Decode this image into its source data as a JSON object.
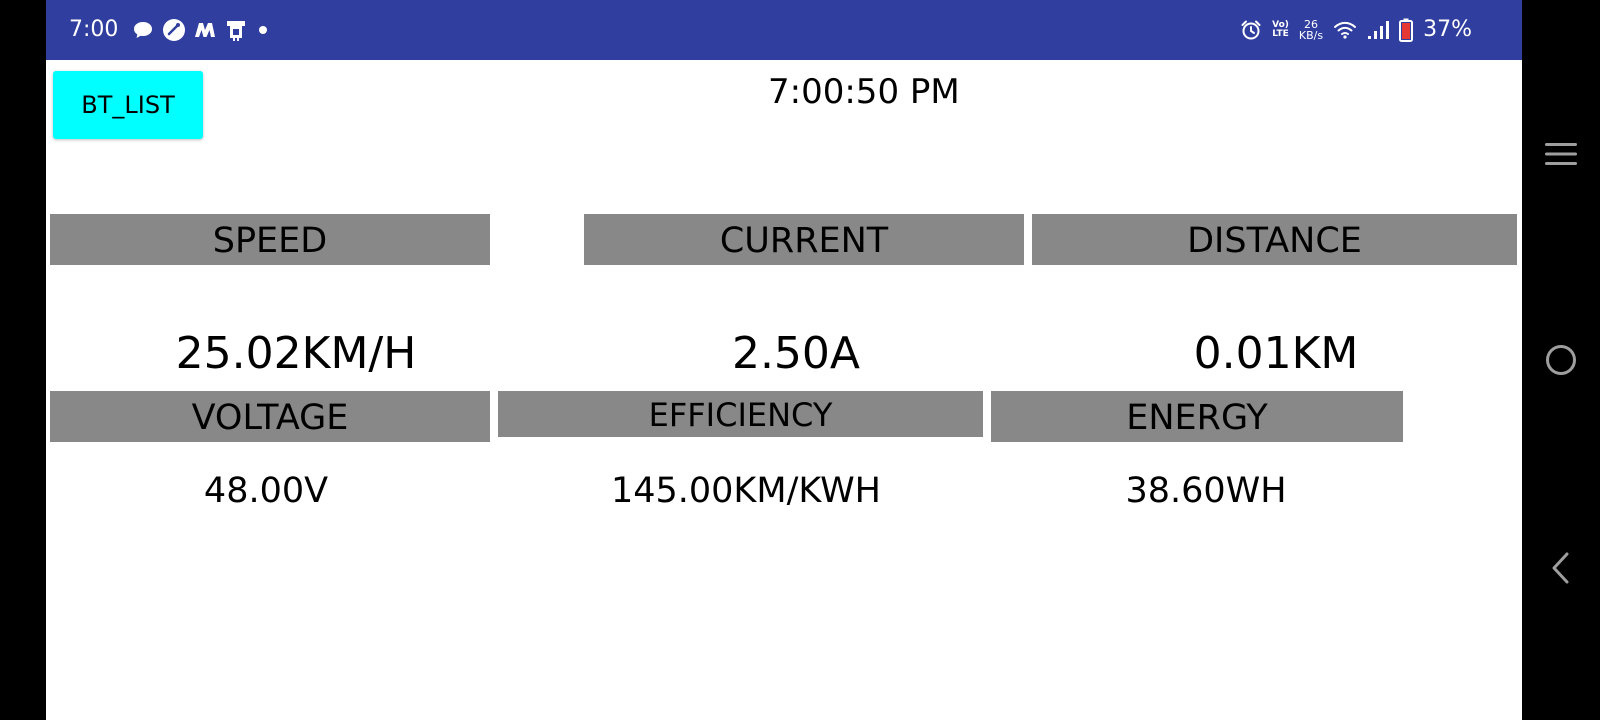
{
  "status_bar": {
    "time": "7:00",
    "notification_icons": [
      "chat-bubble-icon",
      "speed-dial-icon",
      "m-logo-icon",
      "sim-toolkit-icon",
      "dot-icon"
    ],
    "volte": {
      "top": "Vo)",
      "bottom": "LTE"
    },
    "net_speed": {
      "value": "26",
      "unit": "KB/s"
    },
    "battery_percent": "37%",
    "bar_color": "#303f9f"
  },
  "toolbar": {
    "bt_list_label": "BT_LIST",
    "bt_list_color": "#00ffff",
    "clock_text": "7:00:50 PM"
  },
  "metrics": {
    "speed": {
      "label": "SPEED",
      "value": "25.02KM/H"
    },
    "current": {
      "label": "CURRENT",
      "value": "2.50A"
    },
    "distance": {
      "label": "DISTANCE",
      "value": "0.01KM"
    },
    "voltage": {
      "label": "VOLTAGE",
      "value": "48.00V"
    },
    "efficiency": {
      "label": "EFFICIENCY",
      "value": "145.00KM/KWH"
    },
    "energy": {
      "label": "ENERGY",
      "value": "38.60WH"
    }
  },
  "colors": {
    "header_background": "#888888",
    "screen_background": "#ffffff"
  },
  "nav_bar": {
    "icons": [
      "menu-icon",
      "home-icon",
      "back-icon"
    ]
  }
}
